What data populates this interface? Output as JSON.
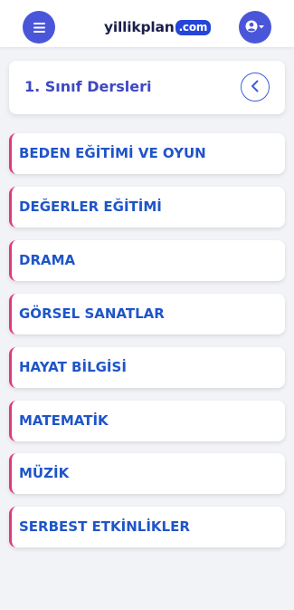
{
  "header": {
    "logo_text": "yillikplan",
    "logo_domain": ".com",
    "menu_icon": "hamburger-menu-icon",
    "user_icon": "user-circle-icon"
  },
  "category": {
    "title": "1. Sınıf Dersleri",
    "back_icon": "chevron-left-icon"
  },
  "courses": [
    "BEDEN EĞİTİMİ VE OYUN",
    "DEĞERLER EĞİTİMİ",
    "DRAMA",
    "GÖRSEL SANATLAR",
    "HAYAT BİLGİSİ",
    "MATEMATİK",
    "MÜZİK",
    "SERBEST ETKİNLİKLER"
  ],
  "colors": {
    "primary": "#4a56d9",
    "accent_border": "#e03a7a",
    "course_text": "#1f55c9",
    "title_text": "#3e48c4"
  }
}
